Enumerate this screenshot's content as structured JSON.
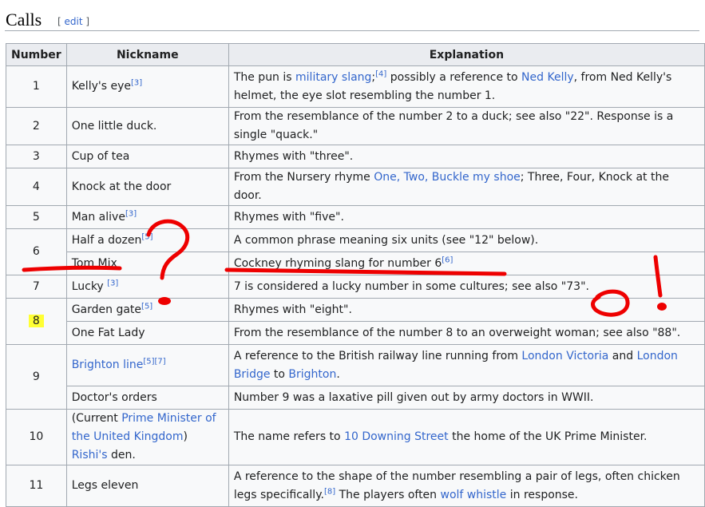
{
  "section": {
    "title": "Calls",
    "edit_open": "[ ",
    "edit_label": "edit",
    "edit_close": " ]"
  },
  "table": {
    "headers": [
      "Number",
      "Nickname",
      "Explanation"
    ],
    "rows": [
      {
        "number": "1",
        "nickname": [
          {
            "t": "Kelly's eye"
          },
          {
            "ref": "[3]"
          }
        ],
        "explanation": [
          {
            "t": "The pun is "
          },
          {
            "link": "military slang"
          },
          {
            "t": ";"
          },
          {
            "ref": "[4]"
          },
          {
            "t": " possibly a reference to "
          },
          {
            "link": "Ned Kelly"
          },
          {
            "t": ", from Ned Kelly's helmet, the eye slot resembling the number 1."
          }
        ]
      },
      {
        "number": "2",
        "nickname": [
          {
            "t": "One little duck."
          }
        ],
        "explanation": [
          {
            "t": "From the resemblance of the number 2 to a duck; see also \"22\". Response is a single \"quack.\""
          }
        ]
      },
      {
        "number": "3",
        "nickname": [
          {
            "t": "Cup of tea"
          }
        ],
        "explanation": [
          {
            "t": "Rhymes with \"three\"."
          }
        ]
      },
      {
        "number": "4",
        "nickname": [
          {
            "t": "Knock at the door"
          }
        ],
        "explanation": [
          {
            "t": "From the Nursery rhyme "
          },
          {
            "link": "One, Two, Buckle my shoe"
          },
          {
            "t": "; Three, Four, Knock at the door."
          }
        ]
      },
      {
        "number": "5",
        "nickname": [
          {
            "t": "Man alive"
          },
          {
            "ref": "[3]"
          }
        ],
        "explanation": [
          {
            "t": "Rhymes with \"five\"."
          }
        ]
      },
      {
        "number": "6",
        "rowspan": 2,
        "nickname": [
          {
            "t": "Half a dozen"
          },
          {
            "ref": "[5]"
          }
        ],
        "explanation": [
          {
            "t": "A common phrase meaning six units (see \"12\" below)."
          }
        ]
      },
      {
        "nickname": [
          {
            "t": "Tom Mix"
          }
        ],
        "explanation": [
          {
            "t": "Cockney rhyming slang for number 6"
          },
          {
            "ref": "[6]"
          }
        ]
      },
      {
        "number": "7",
        "nickname": [
          {
            "t": "Lucky "
          },
          {
            "ref": "[3]"
          }
        ],
        "explanation": [
          {
            "t": "7 is considered a lucky number in some cultures; see also \"73\"."
          }
        ]
      },
      {
        "number": "8",
        "rowspan": 2,
        "highlight": true,
        "nickname": [
          {
            "t": "Garden gate"
          },
          {
            "ref": "[5]"
          }
        ],
        "explanation": [
          {
            "t": "Rhymes with \"eight\"."
          }
        ]
      },
      {
        "nickname": [
          {
            "t": "One Fat Lady"
          }
        ],
        "explanation": [
          {
            "t": "From the resemblance of the number 8 to an overweight woman; see also \"88\"."
          }
        ]
      },
      {
        "number": "9",
        "rowspan": 2,
        "nickname": [
          {
            "link": "Brighton line"
          },
          {
            "ref": "[5]"
          },
          {
            "ref": "[7]"
          }
        ],
        "explanation": [
          {
            "t": "A reference to the British railway line running from "
          },
          {
            "link": "London Victoria"
          },
          {
            "t": " and "
          },
          {
            "link": "London Bridge"
          },
          {
            "t": " to "
          },
          {
            "link": "Brighton"
          },
          {
            "t": "."
          }
        ]
      },
      {
        "nickname": [
          {
            "t": "Doctor's orders"
          }
        ],
        "explanation": [
          {
            "t": "Number 9 was a laxative pill given out by army doctors in WWII."
          }
        ]
      },
      {
        "number": "10",
        "nickname": [
          {
            "t": "(Current "
          },
          {
            "link": "Prime Minister of the United Kingdom"
          },
          {
            "t": ") "
          },
          {
            "link": "Rishi's"
          },
          {
            "t": " den."
          }
        ],
        "explanation": [
          {
            "t": "The name refers to "
          },
          {
            "link": "10 Downing Street"
          },
          {
            "t": " the home of the UK Prime Minister."
          }
        ]
      },
      {
        "number": "11",
        "nickname": [
          {
            "t": "Legs eleven"
          }
        ],
        "explanation": [
          {
            "t": "A reference to the shape of the number resembling a pair of legs, often chicken legs specifically."
          },
          {
            "ref": "[8]"
          },
          {
            "t": " The players often "
          },
          {
            "link": "wolf whistle"
          },
          {
            "t": " in response."
          }
        ]
      }
    ]
  },
  "colors": {
    "link": "#3366cc",
    "header_bg": "#eaecf0",
    "cell_bg": "#f8f9fa",
    "border": "#a2a9b1",
    "highlight": "#ffff33",
    "ink": "#ee0000"
  }
}
